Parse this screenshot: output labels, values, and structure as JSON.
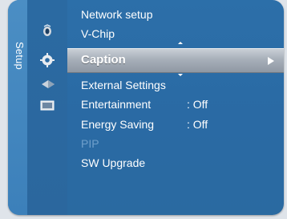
{
  "side_label": "Setup",
  "menu": {
    "items": [
      {
        "label": "Network setup",
        "value": "",
        "enabled": true
      },
      {
        "label": "V-Chip",
        "value": "",
        "enabled": true
      },
      {
        "label": "Caption",
        "value": "",
        "enabled": true,
        "selected": true
      },
      {
        "label": "External Settings",
        "value": "",
        "enabled": true
      },
      {
        "label": "Entertainment",
        "value": ": Off",
        "enabled": true
      },
      {
        "label": "Energy Saving",
        "value": ": Off",
        "enabled": true
      },
      {
        "label": "PIP",
        "value": "",
        "enabled": false
      },
      {
        "label": "SW Upgrade",
        "value": "",
        "enabled": true
      }
    ]
  },
  "icons": {
    "picture": "picture-icon",
    "setup": "setup-gear-icon",
    "input": "input-icon",
    "application": "application-icon"
  },
  "colors": {
    "panel_blue": "#2c6fa9",
    "side_strip": "#4b8ec4",
    "highlight_top": "#c9cfd6",
    "highlight_bottom": "#8f98a3",
    "disabled_text": "#6fa0cb"
  }
}
